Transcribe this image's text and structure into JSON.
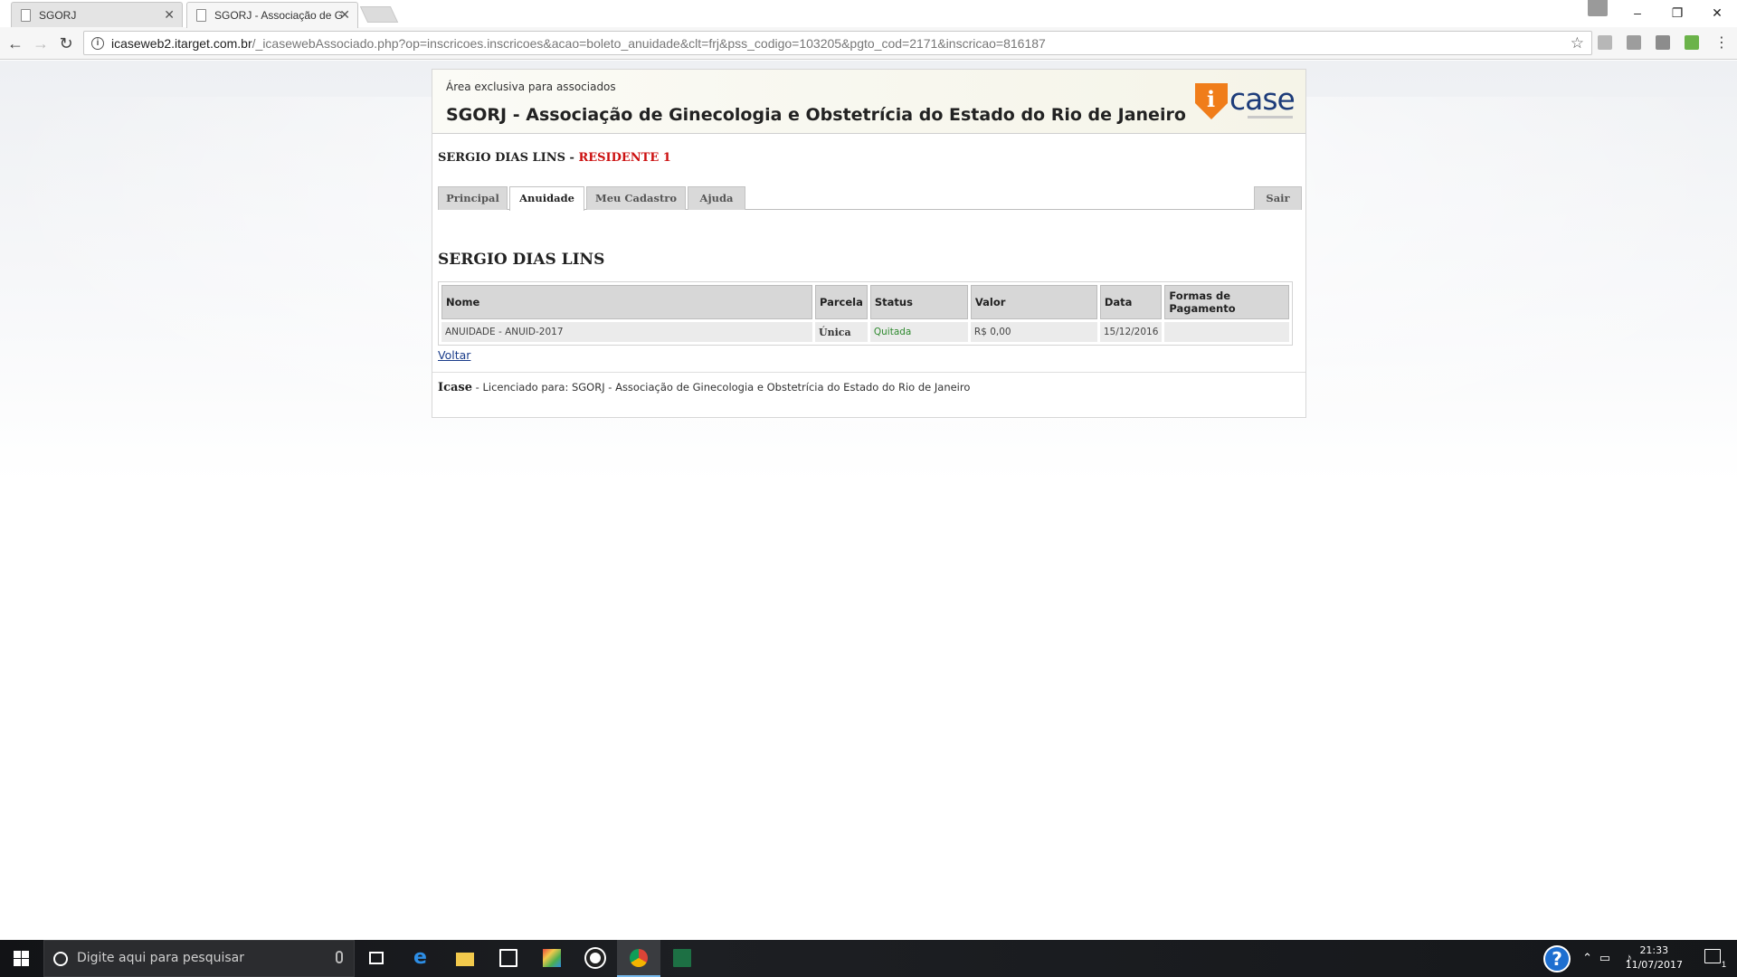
{
  "browser": {
    "tabs": [
      {
        "title": "SGORJ",
        "active": false
      },
      {
        "title": "SGORJ - Associação de G",
        "active": true
      }
    ],
    "url_host": "icaseweb2.itarget.com.br",
    "url_path": "/_icasewebAssociado.php?op=inscricoes.inscricoes&acao=boleto_anuidade&clt=frj&pss_codigo=103205&pgto_cod=2171&inscricao=816187",
    "window_controls": {
      "minimize": "–",
      "restore": "❐",
      "close": "✕"
    }
  },
  "header": {
    "area_label": "Área exclusiva para associados",
    "org_title": "SGORJ - Associação de Ginecologia e Obstetrícia do Estado do Rio de Janeiro",
    "logo_text": "case",
    "logo_mark": "i"
  },
  "user": {
    "name": "SERGIO DIAS LINS",
    "separator": " - ",
    "role": "RESIDENTE 1"
  },
  "nav": {
    "tabs": [
      "Principal",
      "Anuidade",
      "Meu Cadastro",
      "Ajuda"
    ],
    "active": "Anuidade",
    "logout": "Sair"
  },
  "section": {
    "title": "SERGIO DIAS LINS"
  },
  "table": {
    "headers": [
      "Nome",
      "Parcela",
      "Status",
      "Valor",
      "Data",
      "Formas de Pagamento"
    ],
    "rows": [
      [
        "ANUIDADE - ANUID-2017",
        "Única",
        "Quitada",
        "R$ 0,00",
        "15/12/2016",
        ""
      ]
    ]
  },
  "back_link": "Voltar",
  "footer": {
    "brand": "Icase",
    "text": " - Licenciado para: SGORJ - Associação de Ginecologia e Obstetrícia do Estado do Rio de Janeiro"
  },
  "taskbar": {
    "search_placeholder": "Digite aqui para pesquisar",
    "time": "21:33",
    "date": "11/07/2017",
    "notification_count": "1",
    "help_glyph": "?"
  },
  "colors": {
    "role_red": "#cc1111",
    "status_green": "#2f8a2f",
    "logo_orange": "#f07d1a",
    "logo_blue": "#1d3c7a",
    "link_blue": "#1a3c8a"
  }
}
